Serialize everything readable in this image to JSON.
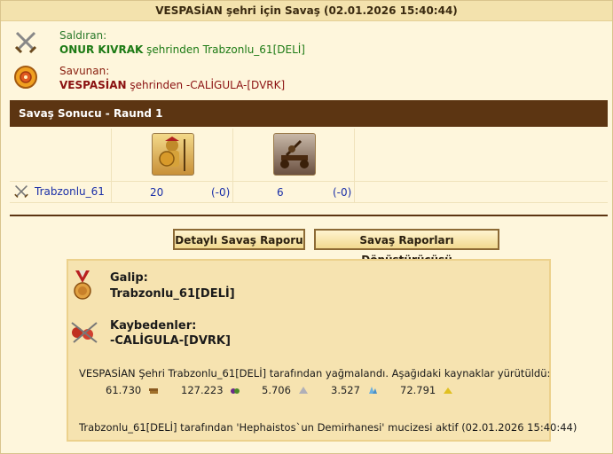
{
  "header": {
    "title": "VESPASİAN şehri için Savaş (02.01.2026 15:40:44)"
  },
  "attacker": {
    "label": "Saldıran:",
    "player": "ONUR KIVRAK",
    "rest": " şehrinden Trabzonlu_61[DELİ]"
  },
  "defender": {
    "label": "Savunan:",
    "city": "VESPASİAN",
    "rest": " şehrinden -CALİGULA-[DVRK]"
  },
  "round": {
    "title": "Savaş Sonucu - Raund 1"
  },
  "battle": {
    "row_name": "Trabzonlu_61",
    "units": [
      {
        "count": "20",
        "loss": "(-0)"
      },
      {
        "count": "6",
        "loss": "(-0)"
      }
    ]
  },
  "buttons": {
    "detailed": "Detaylı Savaş Raporu",
    "converter": "Savaş Raporları Dönüştürücüsü"
  },
  "result": {
    "winner_label": "Galip:",
    "winner_name": "Trabzonlu_61[DELİ]",
    "losers_label": "Kaybedenler:",
    "losers_name": "-CALİGULA-[DVRK]",
    "loot_text": "VESPASİAN Şehri Trabzonlu_61[DELİ] tarafından yağmalandı. Aşağıdaki kaynaklar yürütüldü:",
    "resources": [
      {
        "value": "61.730",
        "icon": "wood-icon"
      },
      {
        "value": "127.223",
        "icon": "wine-icon"
      },
      {
        "value": "5.706",
        "icon": "marble-icon"
      },
      {
        "value": "3.527",
        "icon": "crystal-icon"
      },
      {
        "value": "72.791",
        "icon": "sulfur-icon"
      }
    ],
    "wonder_text": "Trabzonlu_61[DELİ] tarafından 'Hephaistos`un Demirhanesi' mucizesi aktif (02.01.2026 15:40:44)"
  }
}
